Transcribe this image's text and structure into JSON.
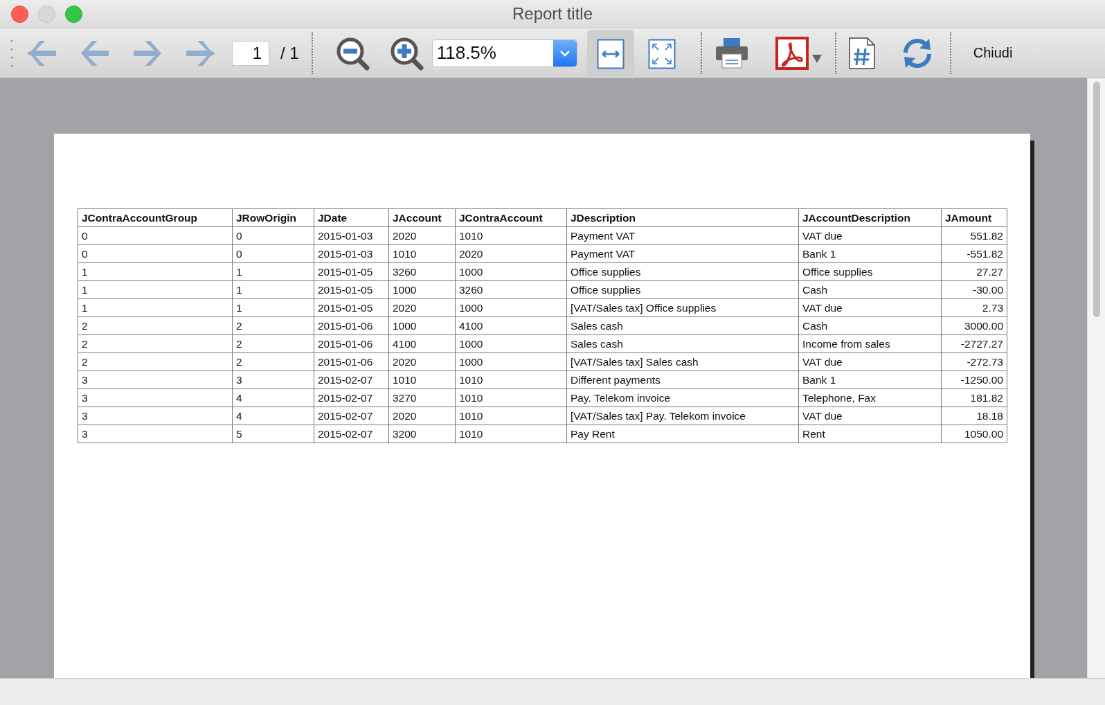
{
  "window": {
    "title": "Report title"
  },
  "toolbar": {
    "nav_buttons": [
      {
        "kind": "first",
        "disabled": true
      },
      {
        "kind": "previous",
        "disabled": true
      },
      {
        "kind": "next",
        "disabled": true
      },
      {
        "kind": "last",
        "disabled": true
      }
    ],
    "page": {
      "value": "1",
      "total": "/ 1"
    },
    "zoom": {
      "value": "118.5%"
    },
    "fit_buttons": [
      {
        "kind": "width",
        "selected": true
      },
      {
        "kind": "page",
        "selected": false
      }
    ],
    "close_button": "Chiudi"
  },
  "table": {
    "columns": [
      "JContraAccountGroup",
      "JRowOrigin",
      "JDate",
      "JAccount",
      "JContraAccount",
      "JDescription",
      "JAccountDescription",
      "JAmount"
    ],
    "rows": [
      [
        "0",
        "0",
        "2015-01-03",
        "2020",
        "1010",
        "Payment VAT",
        "VAT due",
        "551.82"
      ],
      [
        "0",
        "0",
        "2015-01-03",
        "1010",
        "2020",
        "Payment VAT",
        "Bank 1",
        "-551.82"
      ],
      [
        "1",
        "1",
        "2015-01-05",
        "3260",
        "1000",
        "Office supplies",
        "Office supplies",
        "27.27"
      ],
      [
        "1",
        "1",
        "2015-01-05",
        "1000",
        "3260",
        "Office supplies",
        "Cash",
        "-30.00"
      ],
      [
        "1",
        "1",
        "2015-01-05",
        "2020",
        "1000",
        "[VAT/Sales tax] Office supplies",
        "VAT due",
        "2.73"
      ],
      [
        "2",
        "2",
        "2015-01-06",
        "1000",
        "4100",
        "Sales cash",
        "Cash",
        "3000.00"
      ],
      [
        "2",
        "2",
        "2015-01-06",
        "4100",
        "1000",
        "Sales cash",
        "Income from sales",
        "-2727.27"
      ],
      [
        "2",
        "2",
        "2015-01-06",
        "2020",
        "1000",
        "[VAT/Sales tax] Sales cash",
        "VAT due",
        "-272.73"
      ],
      [
        "3",
        "3",
        "2015-02-07",
        "1010",
        "1010",
        "Different payments",
        "Bank 1",
        "-1250.00"
      ],
      [
        "3",
        "4",
        "2015-02-07",
        "3270",
        "1010",
        "Pay. Telekom invoice",
        "Telephone, Fax",
        "181.82"
      ],
      [
        "3",
        "4",
        "2015-02-07",
        "2020",
        "1010",
        "[VAT/Sales tax] Pay. Telekom invoice",
        "VAT due",
        "18.18"
      ],
      [
        "3",
        "5",
        "2015-02-07",
        "3200",
        "1010",
        "Pay Rent",
        "Rent",
        "1050.00"
      ]
    ]
  }
}
